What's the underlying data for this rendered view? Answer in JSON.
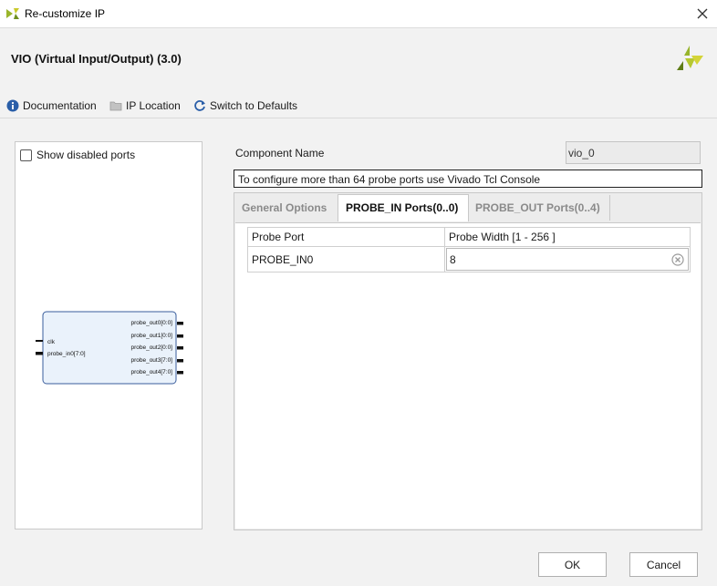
{
  "window": {
    "title": "Re-customize IP",
    "close_icon": "close-icon",
    "app_icon": "vivado-icon"
  },
  "header": {
    "ip_title": "VIO (Virtual Input/Output) (3.0)",
    "logo_icon": "xilinx-logo"
  },
  "toolbar": {
    "documentation": "Documentation",
    "ip_location": "IP Location",
    "switch_defaults": "Switch to Defaults"
  },
  "left_panel": {
    "show_disabled_ports_label": "Show disabled ports",
    "show_disabled_ports_checked": false,
    "block": {
      "inputs": [
        "clk",
        "probe_in0[7:0]"
      ],
      "outputs": [
        "probe_out0[0:0]",
        "probe_out1[0:0]",
        "probe_out2[0:0]",
        "probe_out3[7:0]",
        "probe_out4[7:0]"
      ]
    }
  },
  "right_panel": {
    "component_name_label": "Component Name",
    "component_name_value": "vio_0",
    "notice": "To configure more than 64 probe ports use Vivado Tcl Console",
    "tabs": [
      "General Options",
      "PROBE_IN Ports(0..0)",
      "PROBE_OUT Ports(0..4)"
    ],
    "active_tab": "PROBE_IN Ports(0..0)",
    "table": {
      "headers": [
        "Probe Port",
        "Probe Width [1 - 256 ]"
      ],
      "rows": [
        {
          "port": "PROBE_IN0",
          "width": "8"
        }
      ]
    }
  },
  "buttons": {
    "ok": "OK",
    "cancel": "Cancel"
  },
  "colors": {
    "accent_green": "#8fb02a",
    "info_blue": "#2a5ea8",
    "block_fill": "#eaf2fb",
    "block_border": "#3a5d9c"
  }
}
